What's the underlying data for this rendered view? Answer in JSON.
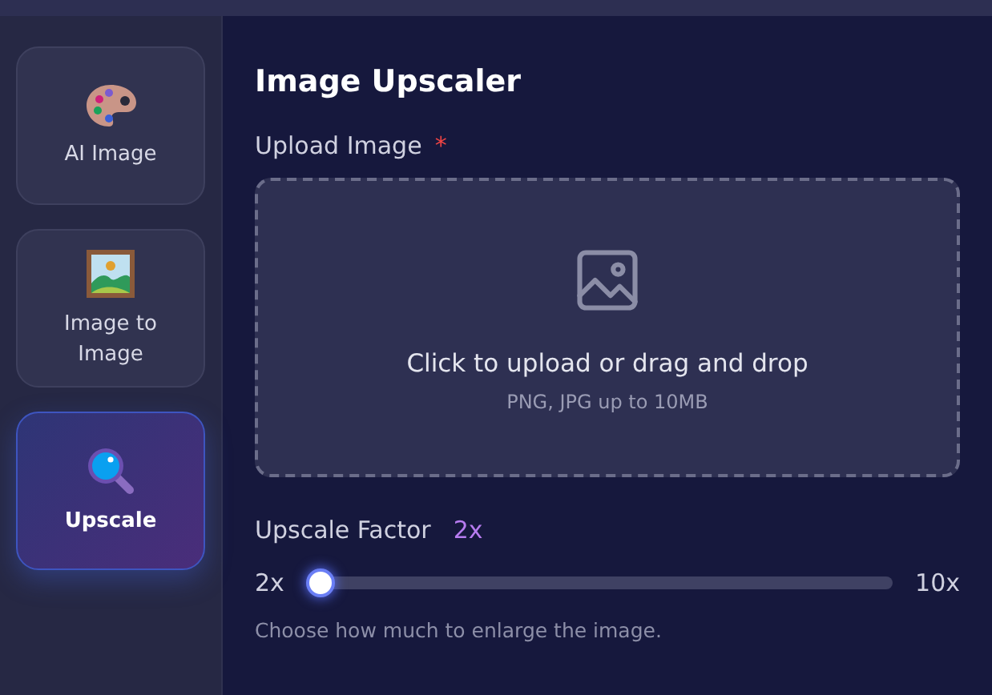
{
  "sidebar": {
    "items": [
      {
        "label": "AI Image",
        "kind": "palette",
        "selected": false
      },
      {
        "label": "Image to Image",
        "kind": "frame",
        "selected": false
      },
      {
        "label": "Upscale",
        "kind": "magnifier",
        "selected": true
      }
    ]
  },
  "main": {
    "title": "Image Upscaler",
    "upload": {
      "label": "Upload Image",
      "required_mark": "*",
      "prompt": "Click to upload or drag and drop",
      "hint": "PNG, JPG up to 10MB"
    },
    "factor": {
      "label": "Upscale Factor",
      "value": "2x",
      "min_label": "2x",
      "max_label": "10x",
      "level": 0,
      "help": "Choose how much to enlarge the image."
    }
  }
}
